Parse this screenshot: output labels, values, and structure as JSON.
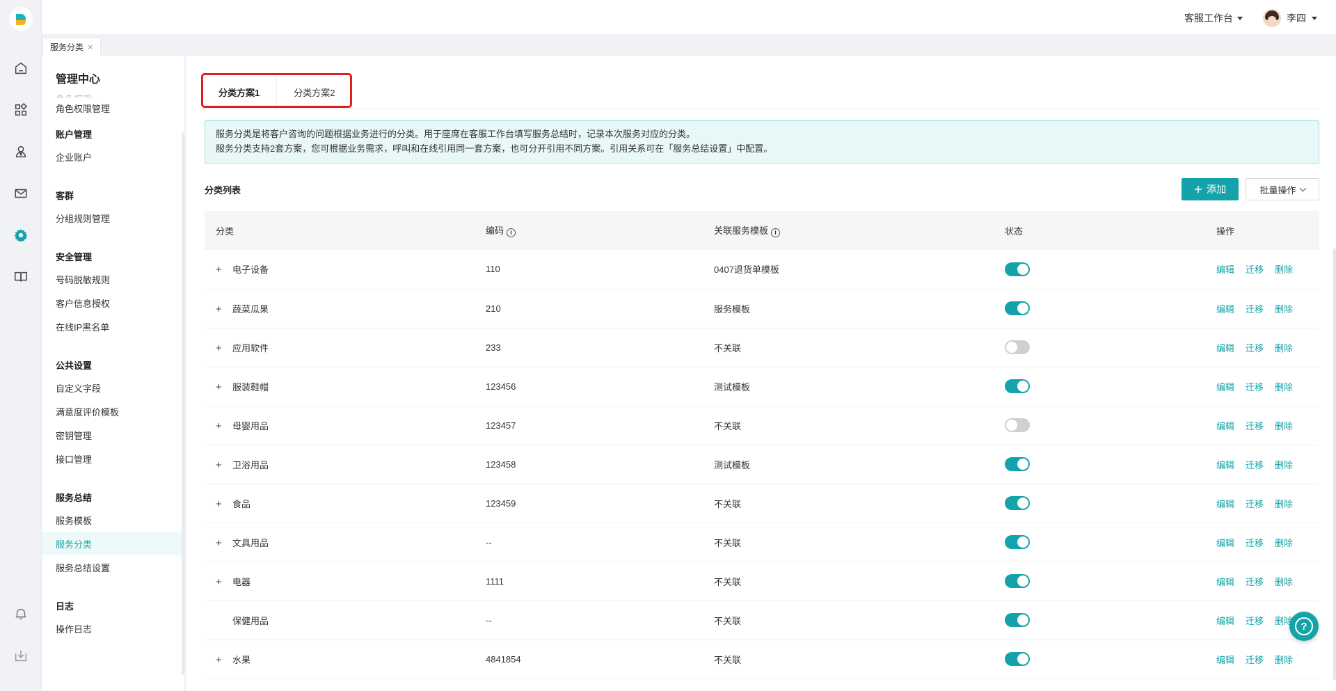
{
  "topbar": {
    "workbench": "客服工作台",
    "user_name": "李四"
  },
  "page_tab": {
    "label": "服务分类",
    "close": "×"
  },
  "sidebar": {
    "title": "管理中心",
    "faded_item": "角色权限",
    "groups": [
      {
        "head": "",
        "items": [
          "角色权限管理"
        ]
      },
      {
        "head": "账户管理",
        "items": [
          "企业账户"
        ]
      },
      {
        "head": "客群",
        "items": [
          "分组规则管理"
        ]
      },
      {
        "head": "安全管理",
        "items": [
          "号码脱敏规则",
          "客户信息授权",
          "在线IP黑名单"
        ]
      },
      {
        "head": "公共设置",
        "items": [
          "自定义字段",
          "满意度评价模板",
          "密钥管理",
          "接口管理"
        ]
      },
      {
        "head": "服务总结",
        "items": [
          "服务模板",
          "服务分类",
          "服务总结设置"
        ]
      },
      {
        "head": "日志",
        "items": [
          "操作日志"
        ]
      }
    ],
    "active_item": "服务分类"
  },
  "scheme_tabs": [
    "分类方案1",
    "分类方案2"
  ],
  "notice": {
    "line1": "服务分类是将客户咨询的问题根据业务进行的分类。用于座席在客服工作台填写服务总结时，记录本次服务对应的分类。",
    "line2": "服务分类支持2套方案，您可根据业务需求，呼叫和在线引用同一套方案，也可分开引用不同方案。引用关系可在「服务总结设置」中配置。"
  },
  "list": {
    "title": "分类列表",
    "add_label": "添加",
    "batch_label": "批量操作",
    "columns": [
      "分类",
      "编码",
      "关联服务模板",
      "状态",
      "操作"
    ],
    "ops": [
      "编辑",
      "迁移",
      "删除"
    ],
    "rows": [
      {
        "name": "电子设备",
        "code": "110",
        "template": "0407退货单模板",
        "enabled": true,
        "expandable": true
      },
      {
        "name": "蔬菜瓜果",
        "code": "210",
        "template": "服务模板",
        "enabled": true,
        "expandable": true
      },
      {
        "name": "应用软件",
        "code": "233",
        "template": "不关联",
        "enabled": false,
        "expandable": true
      },
      {
        "name": "服装鞋帽",
        "code": "123456",
        "template": "测试模板",
        "enabled": true,
        "expandable": true
      },
      {
        "name": "母婴用品",
        "code": "123457",
        "template": "不关联",
        "enabled": false,
        "expandable": true
      },
      {
        "name": "卫浴用品",
        "code": "123458",
        "template": "测试模板",
        "enabled": true,
        "expandable": true
      },
      {
        "name": "食品",
        "code": "123459",
        "template": "不关联",
        "enabled": true,
        "expandable": true
      },
      {
        "name": "文具用品",
        "code": "--",
        "template": "不关联",
        "enabled": true,
        "expandable": true
      },
      {
        "name": "电器",
        "code": "1111",
        "template": "不关联",
        "enabled": true,
        "expandable": true
      },
      {
        "name": "保健用品",
        "code": "--",
        "template": "不关联",
        "enabled": true,
        "expandable": false
      },
      {
        "name": "水果",
        "code": "4841854",
        "template": "不关联",
        "enabled": true,
        "expandable": true
      }
    ]
  },
  "colors": {
    "accent": "#14a3a8",
    "highlight": "#e0201f"
  }
}
